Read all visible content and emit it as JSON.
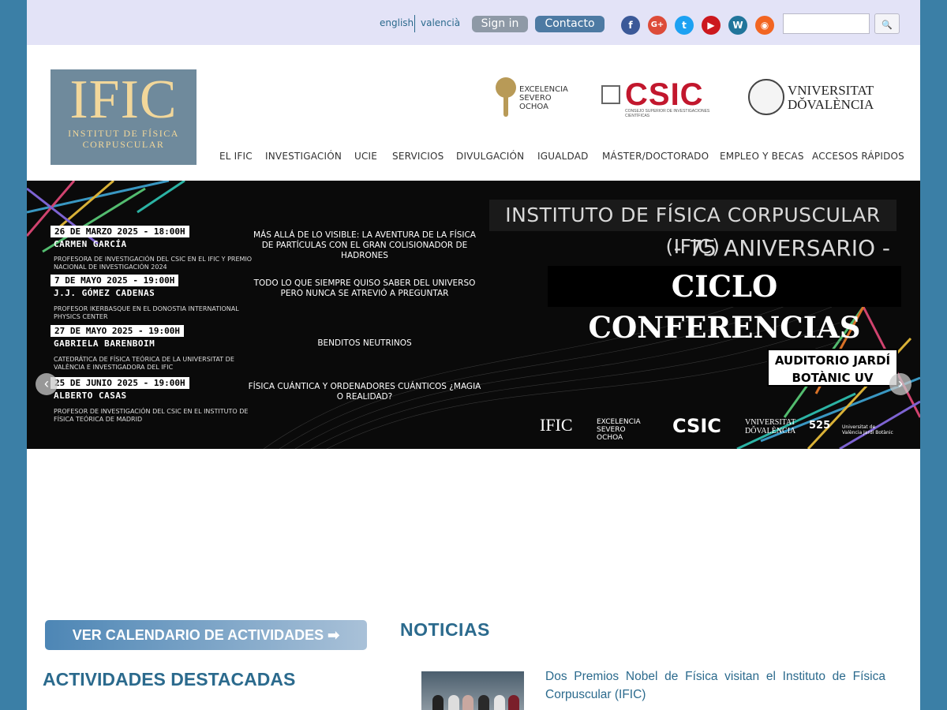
{
  "topbar": {
    "lang_english": "english",
    "lang_valencia": "valencià",
    "signin_label": "Sign in",
    "contacto_label": "Contacto",
    "social": [
      {
        "name": "facebook-icon",
        "glyph": "f"
      },
      {
        "name": "google-plus-icon",
        "glyph": "G+"
      },
      {
        "name": "twitter-icon",
        "glyph": "t"
      },
      {
        "name": "youtube-icon",
        "glyph": "▶"
      },
      {
        "name": "wordpress-icon",
        "glyph": "W"
      },
      {
        "name": "rss-icon",
        "glyph": "◉"
      }
    ],
    "search_placeholder": "",
    "search_glyph": "🔍"
  },
  "header": {
    "logo_big": "IFIC",
    "logo_line1": "INSTITUT DE FÍSICA",
    "logo_line2": "CORPUSCULAR",
    "so_line1": "EXCELENCIA",
    "so_line2": "SEVERO",
    "so_line3": "OCHOA",
    "csic_word": "CSIC",
    "csic_sub": "CONSEJO SUPERIOR DE INVESTIGACIONES CIENTÍFICAS",
    "uv_line1": "VNIVERSITAT",
    "uv_line2": "DǑVALÈNCIA"
  },
  "nav": {
    "items": [
      "EL IFIC",
      "INVESTIGACIÓN",
      "UCIE",
      "SERVICIOS",
      "DIVULGACIÓN",
      "IGUALDAD",
      "MÁSTER/DOCTORADO",
      "EMPLEO Y BECAS",
      "ACCESOS RÁPIDOS"
    ]
  },
  "banner": {
    "events": [
      {
        "date": "26 DE MARZO 2025 - 18:00H",
        "speaker": "CARMEN GARCÍA",
        "affiliation": "PROFESORA DE INVESTIGACIÓN DEL CSIC EN EL IFIC Y PREMIO NACIONAL DE INVESTIGACIÓN 2024",
        "talk": "MÁS ALLÁ DE LO VISIBLE: LA AVENTURA DE LA FÍSICA DE PARTÍCULAS CON EL GRAN COLISIONADOR DE HADRONES"
      },
      {
        "date": "7 DE MAYO 2025 - 19:00H",
        "speaker": "J.J. GÓMEZ CADENAS",
        "affiliation": "PROFESOR IKERBASQUE EN EL DONOSTIA INTERNATIONAL PHYSICS CENTER",
        "talk": "TODO LO QUE SIEMPRE QUISO SABER DEL UNIVERSO PERO NUNCA SE ATREVIÓ A PREGUNTAR"
      },
      {
        "date": "27 DE MAYO 2025 - 19:00H",
        "speaker": "GABRIELA BARENBOIM",
        "affiliation": "CATEDRÁTICA DE FÍSICA TEÓRICA DE LA UNIVERSITAT DE VALÈNCIA E INVESTIGADORA DEL IFIC",
        "talk": "BENDITOS NEUTRINOS"
      },
      {
        "date": "25 DE JUNIO 2025 - 19:00H",
        "speaker": "ALBERTO CASAS",
        "affiliation": "PROFESOR DE INVESTIGACIÓN DEL CSIC EN EL INSTITUTO DE FÍSICA TEÓRICA DE MADRID",
        "talk": "FÍSICA CUÁNTICA Y ORDENADORES CUÁNTICOS ¿MAGIA O REALIDAD?"
      }
    ],
    "title1": "INSTITUTO DE FÍSICA CORPUSCULAR (IFIC)",
    "title2": "- 75 ANIVERSARIO -",
    "title3": "CICLO CONFERENCIAS",
    "venue_line1": "AUDITORIO JARDÍ",
    "venue_line2": "BOTÀNIC UV",
    "footer_ific": "IFIC",
    "footer_so": "EXCELENCIA SEVERO OCHOA",
    "footer_csic": "CSIC",
    "footer_uv": "VNIVERSITAT DǑVALÈNCIA",
    "footer_anniv": "525",
    "footer_jardi": "Universitat de València Jardí Botànic",
    "prev_glyph": "‹",
    "next_glyph": "›"
  },
  "lower": {
    "calendar_button": "VER CALENDARIO DE ACTIVIDADES ➡",
    "actividades_heading": "ACTIVIDADES DESTACADAS",
    "noticias_heading": "NOTICIAS",
    "news": [
      {
        "title": "Dos Premios Nobel de Física visitan el Instituto de Física Corpuscular (IFIC)"
      }
    ]
  },
  "colors": {
    "accent": "#2b6a8d",
    "side_background": "#3b7fa6",
    "topbar": "#e3e3f7",
    "csic_red": "#c2172d",
    "logo_gold": "#f2d79a"
  }
}
